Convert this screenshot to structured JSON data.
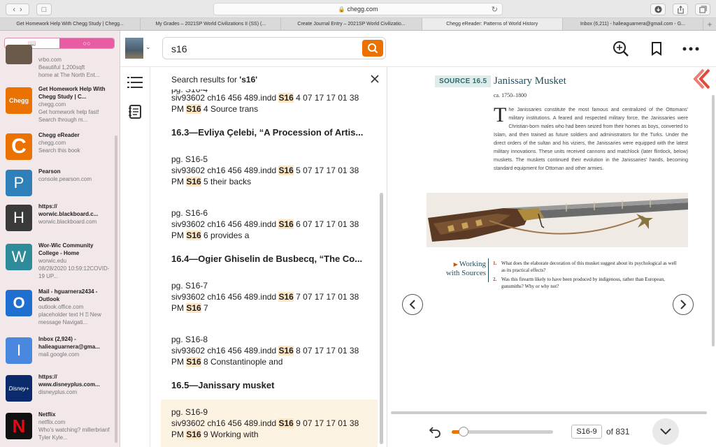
{
  "browser": {
    "url": "chegg.com",
    "tabs": [
      {
        "label": "Get Homework Help With Chegg Study | Chegg...",
        "active": false
      },
      {
        "label": "My Grades – 2021SP World Civilizations II (SS) (...",
        "active": false
      },
      {
        "label": "Create Journal Entry – 2021SP World Civilizatio...",
        "active": false
      },
      {
        "label": "Chegg eReader: Patterns of World History",
        "active": true
      },
      {
        "label": "Inbox (6,211) - halieaguarnera@gmail.com - G...",
        "active": false
      }
    ]
  },
  "sidebar": {
    "items": [
      {
        "line1": "vrbo.com",
        "line2": "Beautiful 1,200sqft",
        "line3": "home at The North Ent...",
        "icon": "",
        "color": "#6b5a4a"
      },
      {
        "title": "Get Homework Help With Chegg Study | C...",
        "sub": "chegg.com",
        "desc": "Get homework help fast! Search through m...",
        "icon": "Chegg",
        "color": "#eb7100"
      },
      {
        "title": "Chegg eReader",
        "sub": "chegg.com",
        "desc": "Search this book",
        "icon": "C",
        "color": "#eb7100"
      },
      {
        "title": "Pearson",
        "sub": "console.pearson.com",
        "desc": "",
        "icon": "P",
        "color": "#2f80b8"
      },
      {
        "title": "https:// worwic.blackboard.c...",
        "sub": "worwic.blackboard.com",
        "desc": "",
        "icon": "H",
        "color": "#3a3a3a"
      },
      {
        "title": "Wor-Wic Community College - Home",
        "sub": "worwic.edu",
        "desc": "08/28/2020 10:59:12COVID-19 UP...",
        "icon": "W",
        "color": "#2e8b9a"
      },
      {
        "title": "Mail - hguarnera2434 - Outlook",
        "sub": "outlook.office.com",
        "desc": "placeholder text H ⍰ New message Navigati...",
        "icon": "O",
        "color": "#1f6fd1"
      },
      {
        "title": "Inbox (2,924) - halieaguarnera@gma...",
        "sub": "mail.google.com",
        "desc": "",
        "icon": "I",
        "color": "#4a88e0"
      },
      {
        "title": "https:// www.disneyplus.com...",
        "sub": "disneyplus.com",
        "desc": "",
        "icon": "Disney+",
        "color": "#0b2a6b"
      },
      {
        "title": "Netflix",
        "sub": "netflix.com",
        "desc": "Who's watching? millerbrianf Tyler Kyle...",
        "icon": "N",
        "color": "#111111"
      }
    ]
  },
  "header": {
    "search_value": "s16"
  },
  "results": {
    "heading_prefix": "Search results for ",
    "heading_query": "'s16'",
    "top_partial": "pg. S16-4",
    "blocks": [
      {
        "type": "text",
        "pg": "",
        "pre": "siv93602 ch16 456 489.indd ",
        "hl": "S16",
        "mid": " 4 07 17 17 01 38",
        "pre2": "PM ",
        "hl2": "S16",
        "post": " 4 Source trans"
      },
      {
        "type": "head",
        "text": "16.3—Evliya Çelebi, “A Procession of Artis..."
      },
      {
        "type": "text",
        "pg": "pg. S16-5",
        "pre": "siv93602 ch16 456 489.indd ",
        "hl": "S16",
        "mid": " 5 07 17 17 01 38",
        "pre2": "PM ",
        "hl2": "S16",
        "post": " 5 their backs"
      },
      {
        "type": "text",
        "pg": "pg. S16-6",
        "pre": "siv93602 ch16 456 489.indd ",
        "hl": "S16",
        "mid": " 6 07 17 17 01 38",
        "pre2": "PM ",
        "hl2": "S16",
        "post": " 6 provides a"
      },
      {
        "type": "head",
        "text": "16.4—Ogier Ghiselin de Busbecq, “The Co..."
      },
      {
        "type": "text",
        "pg": "pg. S16-7",
        "pre": "siv93602 ch16 456 489.indd ",
        "hl": "S16",
        "mid": " 7 07 17 17 01 38",
        "pre2": "PM ",
        "hl2": "S16",
        "post": " 7"
      },
      {
        "type": "text",
        "pg": "pg. S16-8",
        "pre": "siv93602 ch16 456 489.indd ",
        "hl": "S16",
        "mid": " 8 07 17 17 01 38",
        "pre2": "PM ",
        "hl2": "S16",
        "post": " 8 Constantinople and"
      },
      {
        "type": "head",
        "text": "16.5—Janissary musket"
      },
      {
        "type": "text",
        "pg": "pg. S16-9",
        "pre": "siv93602 ch16 456 489.indd ",
        "hl": "S16",
        "mid": " 9 07 17 17 01 38",
        "pre2": "PM ",
        "hl2": "S16",
        "post": " 9 Working with",
        "selected": true
      }
    ]
  },
  "book": {
    "source_tag": "SOURCE 16.5",
    "title": "Janissary Musket",
    "date": "ca. 1750–1800",
    "drop_cap": "T",
    "body": "he Janissaries constitute the most famous and centralized of the Ottomans' military institutions. A feared and respected military force, the Janissaries were Christian-born males who had been seized from their homes as boys, converted to Islam, and then trained as future soldiers and administrators for the Turks. Under the direct orders of the sultan and his viziers, the Janissaries were equipped with the latest military innovations. These units received cannons and matchlock (later flintlock, below) muskets. The muskets continued their evolution in the Janissaries' hands, becoming standard equipment for Ottoman and other armies.",
    "wws_line1": "Working",
    "wws_line2": "with Sources",
    "questions": [
      {
        "n": "1.",
        "text": "What does the elaborate decoration of this musket suggest about its psychological as well as its practical effects?"
      },
      {
        "n": "2.",
        "text": "Was this firearm likely to have been produced by indigenous, rather than European, gunsmiths? Why or why not?"
      }
    ]
  },
  "footer": {
    "page_value": "S16-9",
    "page_total": "of 831",
    "progress": 0.12
  },
  "colors": {
    "accent": "#eb7100",
    "highlight": "#fde5c4",
    "teal": "#1e4f5c"
  }
}
